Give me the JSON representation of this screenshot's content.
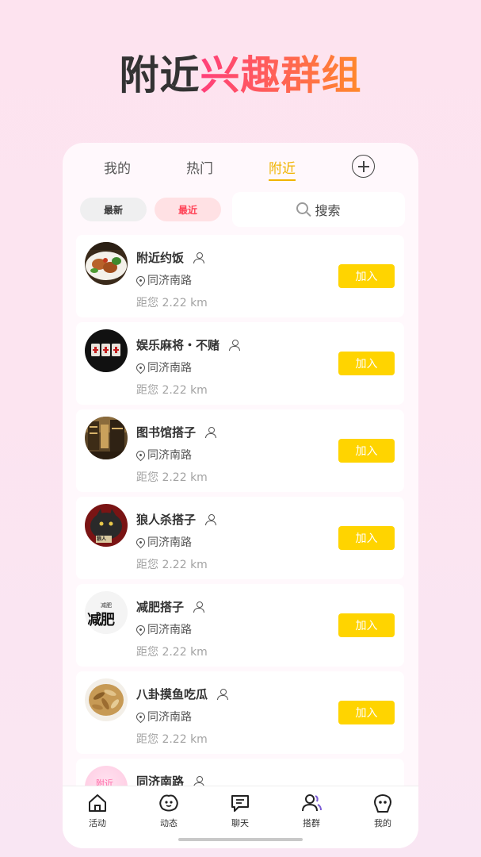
{
  "hero": {
    "title_dark": "附近",
    "title_accent": "兴趣群组"
  },
  "tabs": [
    {
      "label": "我的"
    },
    {
      "label": "热门"
    },
    {
      "label": "附近"
    }
  ],
  "active_tab": "附近",
  "filters": {
    "newest": "最新",
    "recent": "最近"
  },
  "search": {
    "placeholder": "搜索"
  },
  "groups": [
    {
      "name": "附近约饭",
      "location": "同济南路",
      "distance": "距您 2.22 km",
      "join_label": "加入",
      "avatar": "food-photo"
    },
    {
      "name": "娱乐麻将・不赌",
      "location": "同济南路",
      "distance": "距您 2.22 km",
      "join_label": "加入",
      "avatar": "mahjong-photo"
    },
    {
      "name": "图书馆搭子",
      "location": "同济南路",
      "distance": "距您 2.22 km",
      "join_label": "加入",
      "avatar": "library-photo"
    },
    {
      "name": "狼人杀搭子",
      "location": "同济南路",
      "distance": "距您 2.22 km",
      "join_label": "加入",
      "avatar": "werewolf-photo"
    },
    {
      "name": "减肥搭子",
      "location": "同济南路",
      "distance": "距您 2.22 km",
      "join_label": "加入",
      "avatar": "diet-text-image"
    },
    {
      "name": "八卦摸鱼吃瓜",
      "location": "同济南路",
      "distance": "距您 2.22 km",
      "join_label": "加入",
      "avatar": "melon-seeds-photo"
    },
    {
      "name": "同济南路",
      "location": "",
      "distance": "",
      "join_label": "",
      "avatar": "nearby-pink-badge",
      "avatar_text": "附近"
    }
  ],
  "avatar_texts": {
    "diet_small": "减肥",
    "diet_big": "减肥",
    "werewolf_sign": "狼人"
  },
  "tabbar": [
    {
      "label": "活动",
      "icon": "home-icon"
    },
    {
      "label": "动态",
      "icon": "moments-icon"
    },
    {
      "label": "聊天",
      "icon": "chat-icon"
    },
    {
      "label": "搭群",
      "icon": "group-icon"
    },
    {
      "label": "我的",
      "icon": "profile-icon"
    }
  ],
  "colors": {
    "accent_yellow": "#ffd400",
    "active_tab": "#f0b400",
    "recent_red": "#ff4256",
    "hero_gradient_start": "#ff3f7a",
    "hero_gradient_end": "#ff8a2a",
    "group_tab_icon": "#7b5cd6"
  }
}
